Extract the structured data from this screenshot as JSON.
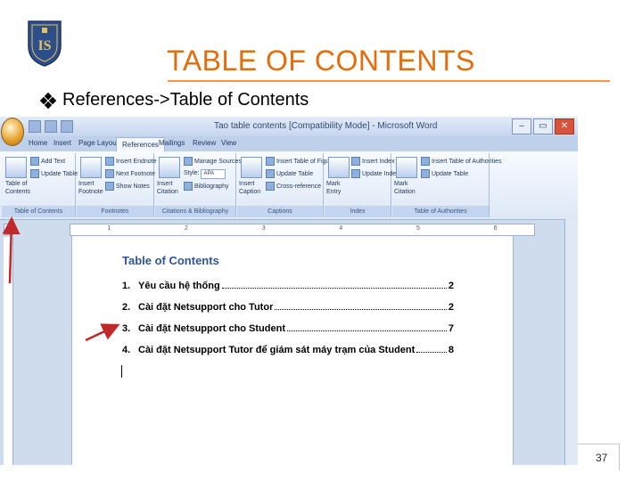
{
  "slide": {
    "title": "TABLE OF CONTENTS",
    "bullet": "References->Table of Contents",
    "page_number": "37",
    "accent_color": "#e46c0a"
  },
  "window": {
    "title": "Tao table contents [Compatibility Mode] - Microsoft Word",
    "controls": [
      "–",
      "▭",
      "✕"
    ]
  },
  "ribbon_tabs": [
    "Home",
    "Insert",
    "Page Layout",
    "References",
    "Mailings",
    "Review",
    "View"
  ],
  "ribbon": {
    "toc_group": {
      "label": "Table of Contents",
      "big_button": "Table of Contents",
      "add_text": "Add Text",
      "update_table": "Update Table"
    },
    "footnotes_group": {
      "label": "Footnotes",
      "insert_footnote_big": "Insert Footnote",
      "insert_endnote": "Insert Endnote",
      "next_footnote": "Next Footnote",
      "show_notes": "Show Notes"
    },
    "citations_group": {
      "label": "Citations & Bibliography",
      "insert_citation": "Insert Citation",
      "manage_sources": "Manage Sources",
      "style_label": "Style:",
      "style_value": "APA",
      "bibliography": "Bibliography"
    },
    "captions_group": {
      "label": "Captions",
      "insert_caption": "Insert Caption",
      "insert_table_of_figures": "Insert Table of Figures",
      "update_table": "Update Table",
      "cross_reference": "Cross-reference"
    },
    "index_group": {
      "label": "Index",
      "mark_entry": "Mark Entry",
      "insert_index": "Insert Index",
      "update_index": "Update Index"
    },
    "authorities_group": {
      "label": "Table of Authorities",
      "mark_citation": "Mark Citation",
      "insert_table_of_authorities": "Insert Table of Authorities",
      "update_table": "Update Table"
    }
  },
  "document": {
    "toc_title": "Table of Contents",
    "entries": [
      {
        "num": "1.",
        "text": "Yêu cầu hệ thống",
        "page": "2"
      },
      {
        "num": "2.",
        "text": "Cài đặt Netsupport cho Tutor",
        "page": "2"
      },
      {
        "num": "3.",
        "text": "Cài đặt Netsupport cho Student",
        "page": "7"
      },
      {
        "num": "4.",
        "text": "Cài đặt Netsupport Tutor để giám sát máy trạm của Student",
        "page": "8"
      }
    ]
  },
  "ruler_numbers": [
    "1",
    "2",
    "3",
    "4",
    "5",
    "6"
  ]
}
